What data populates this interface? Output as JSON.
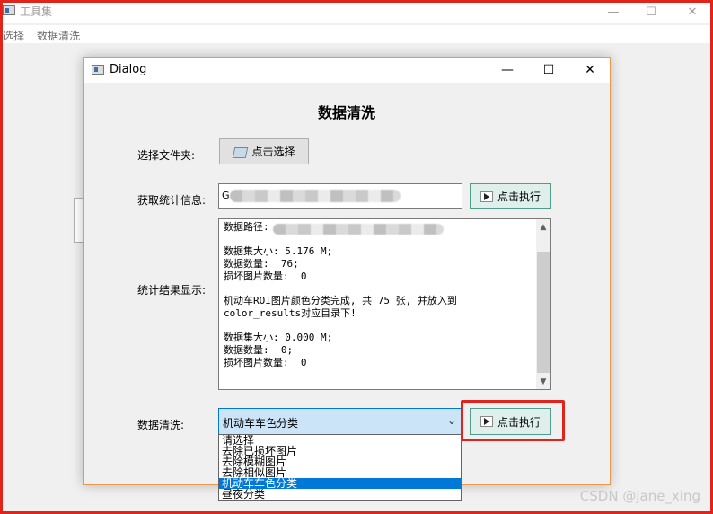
{
  "main_window": {
    "title": "工具集",
    "controls": {
      "minimize": "—",
      "maximize": "☐",
      "close": "✕"
    },
    "menu": [
      "选择",
      "数据清洗"
    ]
  },
  "dialog": {
    "title": "Dialog",
    "controls": {
      "minimize": "—",
      "maximize": "☐",
      "close": "✕"
    },
    "heading": "数据清洗",
    "folder_label": "选择文件夹:",
    "folder_button": "点击选择",
    "stats_label": "获取统计信息:",
    "stats_input_value": "G",
    "stats_exec_button": "点击执行",
    "results_label": "统计结果显示:",
    "results_text": "数据路径:\n\n数据集大小: 5.176 M;\n数据数量:  76;\n损坏图片数量:  0\n\n机动车ROI图片颜色分类完成, 共 75 张, 并放入到\ncolor_results对应目录下!\n\n数据集大小: 0.000 M;\n数据数量:  0;\n损坏图片数量:  0",
    "clean_label": "数据清洗:",
    "clean_selected": "机动车车色分类",
    "clean_exec_button": "点击执行",
    "clean_options": [
      "请选择",
      "去除已损坏图片",
      "去除模糊图片",
      "去除相似图片",
      "机动车车色分类",
      "昼夜分类"
    ],
    "clean_selected_index": 4
  },
  "icons": {
    "folder": "folder-icon",
    "play": "play-icon",
    "chevron": "chevron-down-icon"
  },
  "colors": {
    "highlight": "#e0241b",
    "selection": "#0078d7",
    "exec_button_bg": "#dff0ec"
  },
  "watermark": "CSDN @jane_xing"
}
